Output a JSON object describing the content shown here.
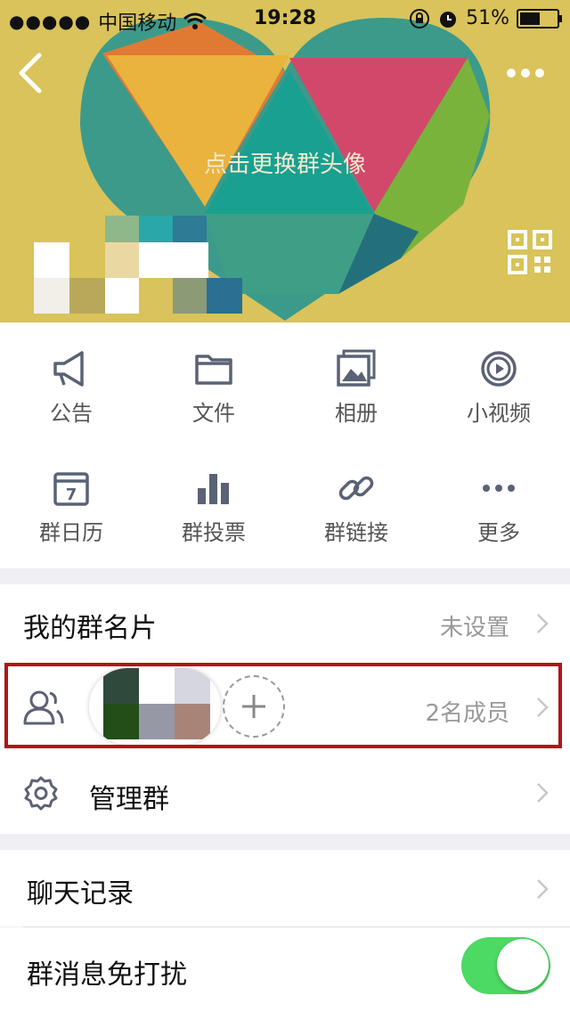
{
  "status_bar": {
    "signal": "●●●●●",
    "carrier": "中国移动",
    "time": "19:28",
    "battery_percent": "51%"
  },
  "header": {
    "change_avatar_text": "点击更换群头像"
  },
  "grid_items": [
    {
      "label": "公告",
      "icon": "megaphone-icon"
    },
    {
      "label": "文件",
      "icon": "folder-icon"
    },
    {
      "label": "相册",
      "icon": "album-icon"
    },
    {
      "label": "小视频",
      "icon": "video-icon"
    },
    {
      "label": "群日历",
      "icon": "calendar-icon",
      "calendar_day": "7"
    },
    {
      "label": "群投票",
      "icon": "bar-chart-icon"
    },
    {
      "label": "群链接",
      "icon": "link-icon"
    },
    {
      "label": "更多",
      "icon": "more-icon"
    }
  ],
  "rows": {
    "group_card": {
      "label": "我的群名片",
      "value": "未设置"
    },
    "members": {
      "count_text": "2名成员"
    },
    "manage": {
      "label": "管理群"
    },
    "chat_history": {
      "label": "聊天记录"
    },
    "mute": {
      "label": "群消息免打扰",
      "enabled": true
    }
  },
  "colors": {
    "toggle_on": "#4cd964",
    "highlight": "#b01319",
    "hero_bg": "#d9c35a"
  }
}
